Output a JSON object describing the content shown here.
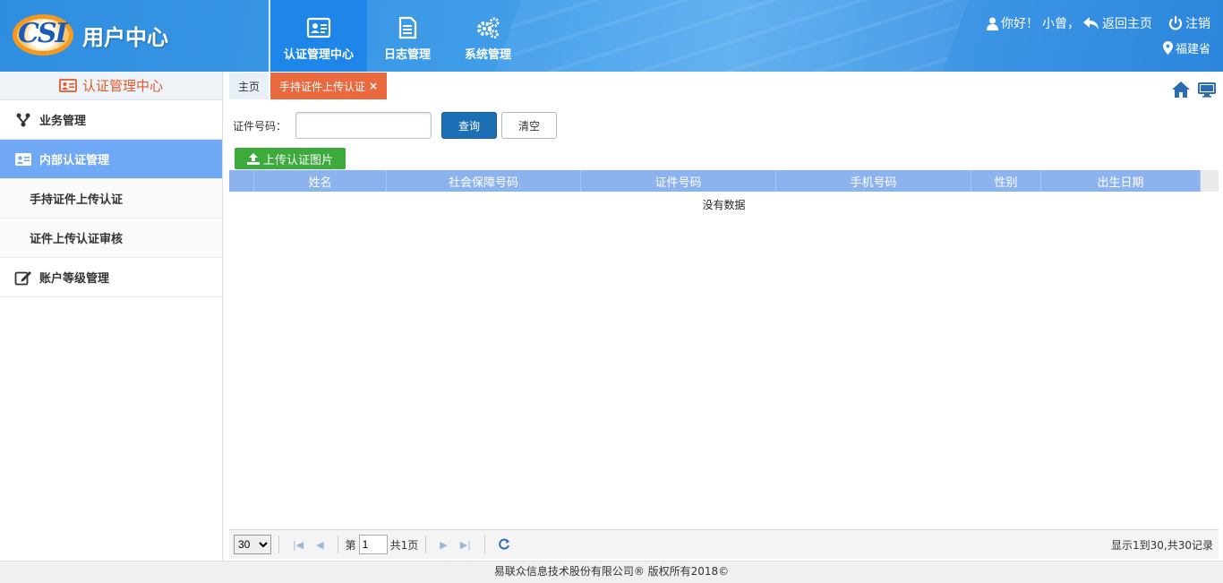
{
  "header": {
    "site_title": "用户中心",
    "logo_text": "CSI",
    "nav": [
      {
        "label": "认证管理中心",
        "icon": "id-card-icon",
        "active": true
      },
      {
        "label": "日志管理",
        "icon": "document-icon",
        "active": false
      },
      {
        "label": "系统管理",
        "icon": "gears-icon",
        "active": false
      }
    ],
    "greeting": "你好！",
    "username": "小曾，",
    "back_home": "返回主页",
    "logout": "注销",
    "region": "福建省"
  },
  "sidebar": {
    "title": "认证管理中心",
    "items": [
      {
        "label": "业务管理",
        "icon": "branch-icon"
      },
      {
        "label": "内部认证管理",
        "icon": "id-card-icon",
        "active": true
      },
      {
        "label": "手持证件上传认证",
        "sub": true
      },
      {
        "label": "证件上传认证审核",
        "sub": true
      },
      {
        "label": "账户等级管理",
        "icon": "edit-icon"
      }
    ]
  },
  "tabs": [
    {
      "label": "主页"
    },
    {
      "label": "手持证件上传认证",
      "close": "×",
      "active": true
    }
  ],
  "search": {
    "label": "证件号码：",
    "value": "",
    "query_button": "查询",
    "clear_button": "清空"
  },
  "upload_button": "上传认证图片",
  "table": {
    "columns": [
      "",
      "姓名",
      "社会保障号码",
      "证件号码",
      "手机号码",
      "性别",
      "出生日期"
    ],
    "empty_text": "没有数据"
  },
  "pager": {
    "page_size": "30",
    "page_prefix": "第",
    "page_value": "1",
    "page_total": "共1页",
    "info": "显示1到30,共30记录"
  },
  "footer": "易联众信息技术股份有限公司® 版权所有2018©",
  "colors": {
    "header_blue": "#2f8de0",
    "active_tab": "#e96a3f",
    "sidebar_active": "#6fa8f5",
    "grid_header": "#8cb3ee",
    "upload_green": "#3cab3c"
  }
}
